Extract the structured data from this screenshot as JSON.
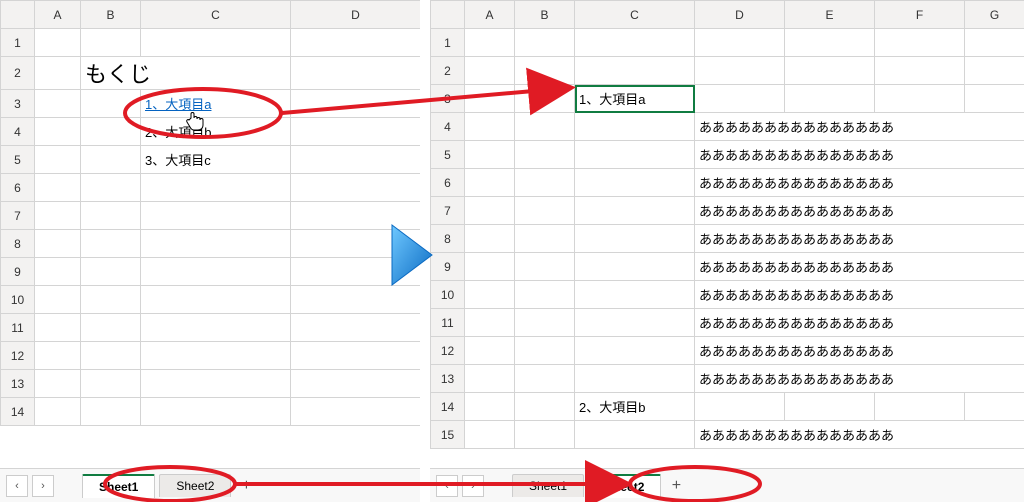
{
  "left": {
    "cols": [
      "A",
      "B",
      "C",
      "D"
    ],
    "rows": [
      1,
      2,
      3,
      4,
      5,
      6,
      7,
      8,
      9,
      10,
      11,
      12,
      13,
      14
    ],
    "heading": "もくじ",
    "items": [
      "1、大項目a",
      "2、大項目b",
      "3、大項目c"
    ],
    "tabs": {
      "sheet1": "Sheet1",
      "sheet2": "Sheet2",
      "add": "+"
    }
  },
  "right": {
    "cols": [
      "A",
      "B",
      "C",
      "D",
      "E",
      "F",
      "G"
    ],
    "rows": [
      1,
      2,
      3,
      4,
      5,
      6,
      7,
      8,
      9,
      10,
      11,
      12,
      13,
      14,
      15
    ],
    "selected": "1、大項目a",
    "bodyline": "あああああああああああああああ",
    "heading2": "2、大項目b",
    "tabs": {
      "sheet1": "Sheet1",
      "sheet2": "Sheet2",
      "add": "+"
    }
  },
  "nav": {
    "prev": "‹",
    "next": "›"
  }
}
